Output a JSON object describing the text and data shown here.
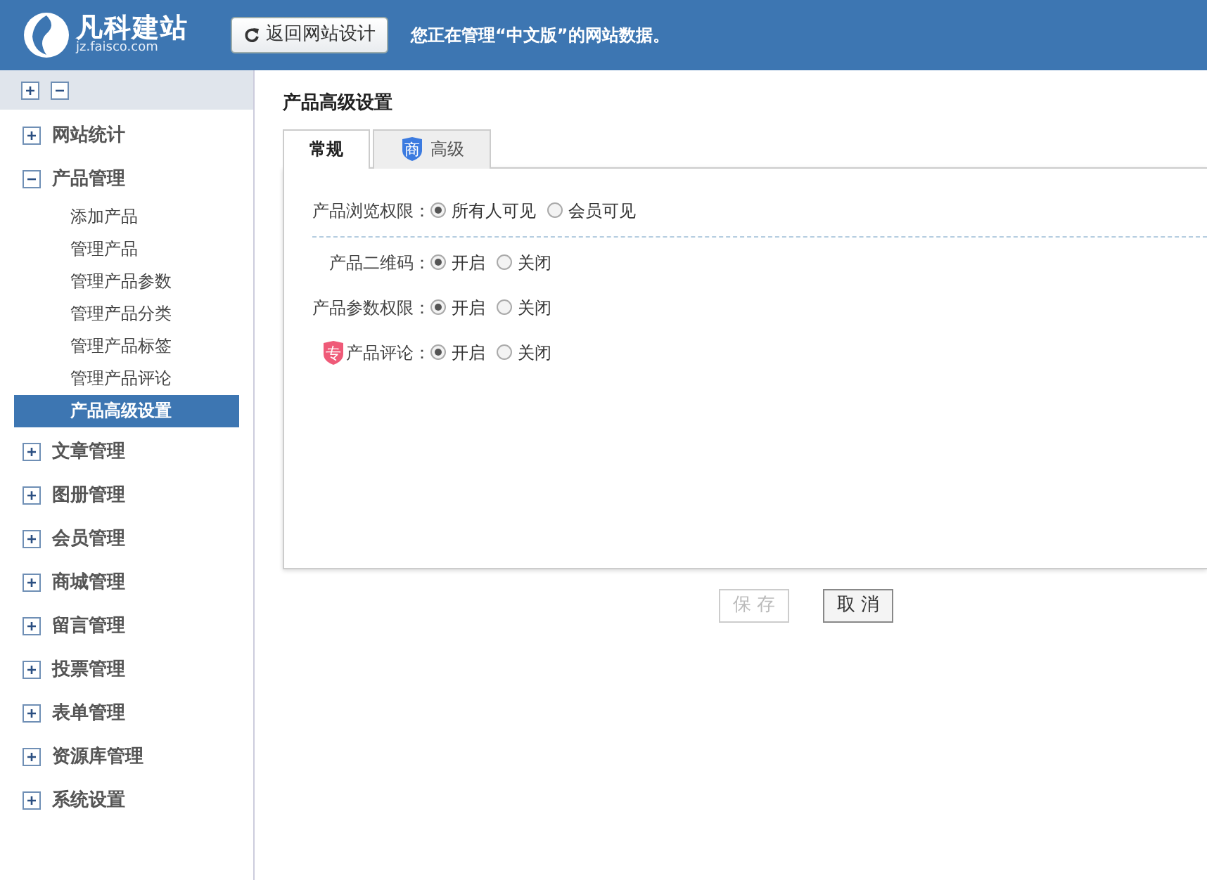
{
  "header": {
    "logo_title": "凡科建站",
    "logo_url": "jz.faisco.com",
    "back_button": "返回网站设计",
    "notice": "您正在管理“中文版”的网站数据。"
  },
  "sidebar": {
    "groups": [
      {
        "label": "网站统计",
        "expanded": false
      },
      {
        "label": "产品管理",
        "expanded": true,
        "children": [
          {
            "label": "添加产品",
            "selected": false
          },
          {
            "label": "管理产品",
            "selected": false
          },
          {
            "label": "管理产品参数",
            "selected": false
          },
          {
            "label": "管理产品分类",
            "selected": false
          },
          {
            "label": "管理产品标签",
            "selected": false
          },
          {
            "label": "管理产品评论",
            "selected": false
          },
          {
            "label": "产品高级设置",
            "selected": true
          }
        ]
      },
      {
        "label": "文章管理",
        "expanded": false
      },
      {
        "label": "图册管理",
        "expanded": false
      },
      {
        "label": "会员管理",
        "expanded": false
      },
      {
        "label": "商城管理",
        "expanded": false
      },
      {
        "label": "留言管理",
        "expanded": false
      },
      {
        "label": "投票管理",
        "expanded": false
      },
      {
        "label": "表单管理",
        "expanded": false
      },
      {
        "label": "资源库管理",
        "expanded": false
      },
      {
        "label": "系统设置",
        "expanded": false
      }
    ]
  },
  "page_title": "产品高级设置",
  "tabs": [
    {
      "label": "常规",
      "selected": true
    },
    {
      "label": "高级",
      "selected": false,
      "badge": "商"
    }
  ],
  "settings": [
    {
      "label": "产品浏览权限：",
      "divider_after": true,
      "options": [
        {
          "label": "所有人可见",
          "selected": true
        },
        {
          "label": "会员可见",
          "selected": false
        }
      ]
    },
    {
      "label": "产品二维码：",
      "options": [
        {
          "label": "开启",
          "selected": true
        },
        {
          "label": "关闭",
          "selected": false
        }
      ]
    },
    {
      "label": "产品参数权限：",
      "options": [
        {
          "label": "开启",
          "selected": true
        },
        {
          "label": "关闭",
          "selected": false
        }
      ]
    },
    {
      "label": "产品评论：",
      "badge": "专",
      "options": [
        {
          "label": "开启",
          "selected": true
        },
        {
          "label": "关闭",
          "selected": false
        }
      ]
    }
  ],
  "buttons": [
    {
      "label": "保 存",
      "disabled": true
    },
    {
      "label": "取 消",
      "disabled": false
    }
  ]
}
